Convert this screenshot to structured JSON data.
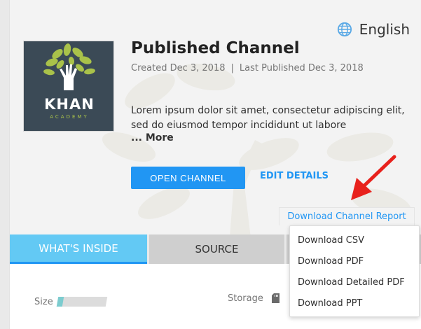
{
  "language": {
    "label": "English",
    "icon": "globe-icon"
  },
  "channel": {
    "title": "Published Channel",
    "created": "Created Dec 3, 2018",
    "separator": "|",
    "last_published": "Last Published Dec 3, 2018",
    "description": "Lorem ipsum dolor sit amet, consectetur adipiscing elit, sed do eiusmod tempor incididunt ut labore",
    "more_label": "... More",
    "thumbnail": {
      "name": "KHAN",
      "subname": "ACADEMY"
    }
  },
  "actions": {
    "open_channel": "OPEN CHANNEL",
    "edit_details": "EDIT DETAILS",
    "download_report": "Download Channel Report"
  },
  "download_menu": {
    "items": [
      "Download CSV",
      "Download PDF",
      "Download Detailed PDF",
      "Download PPT"
    ]
  },
  "tabs": [
    {
      "label": "WHAT'S INSIDE",
      "active": true
    },
    {
      "label": "SOURCE",
      "active": false
    },
    {
      "label": "",
      "active": false
    }
  ],
  "stats": {
    "size_label": "Size",
    "size_fill_fraction": 0.12,
    "storage_label": "Storage"
  },
  "colors": {
    "accent": "#2196f3",
    "active_tab": "#63c9f4",
    "annotation_arrow": "#e8211c",
    "thumbnail_bg": "#3b4a56",
    "leaf_green": "#a9c24a"
  }
}
